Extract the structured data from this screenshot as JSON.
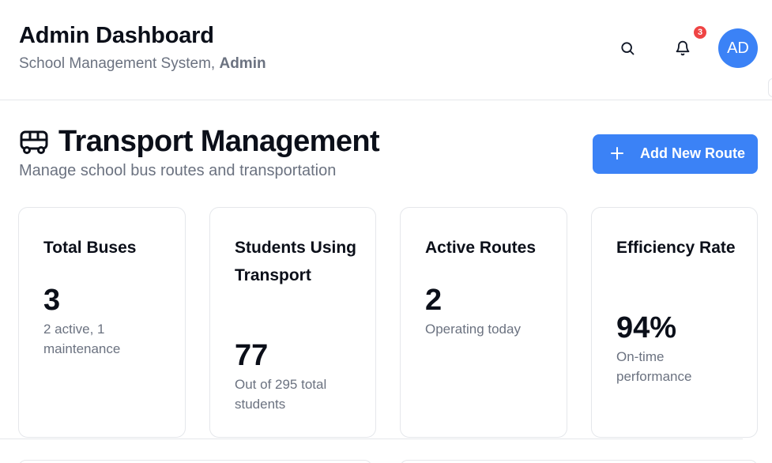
{
  "header": {
    "title": "Admin Dashboard",
    "subtitle_prefix": "School Management System, ",
    "subtitle_role": "Admin",
    "notification_count": "3",
    "avatar_initials": "AD"
  },
  "section": {
    "title": "Transport Management",
    "subtitle": "Manage school bus routes and transportation",
    "add_button_label": "Add New Route"
  },
  "stats": [
    {
      "label": "Total Buses",
      "value": "3",
      "note": "2 active, 1 maintenance"
    },
    {
      "label": "Students Using Transport",
      "value": "77",
      "note": "Out of 295 total students"
    },
    {
      "label": "Active Routes",
      "value": "2",
      "note": "Operating today"
    },
    {
      "label": "Efficiency Rate",
      "value": "94%",
      "note": "On-time performance"
    }
  ],
  "colors": {
    "accent": "#3b82f6",
    "badge": "#ef4444",
    "muted_text": "#6b7280",
    "border": "#e5e7eb"
  },
  "icons": [
    "search-icon",
    "bell-icon",
    "bus-icon",
    "plus-icon"
  ]
}
